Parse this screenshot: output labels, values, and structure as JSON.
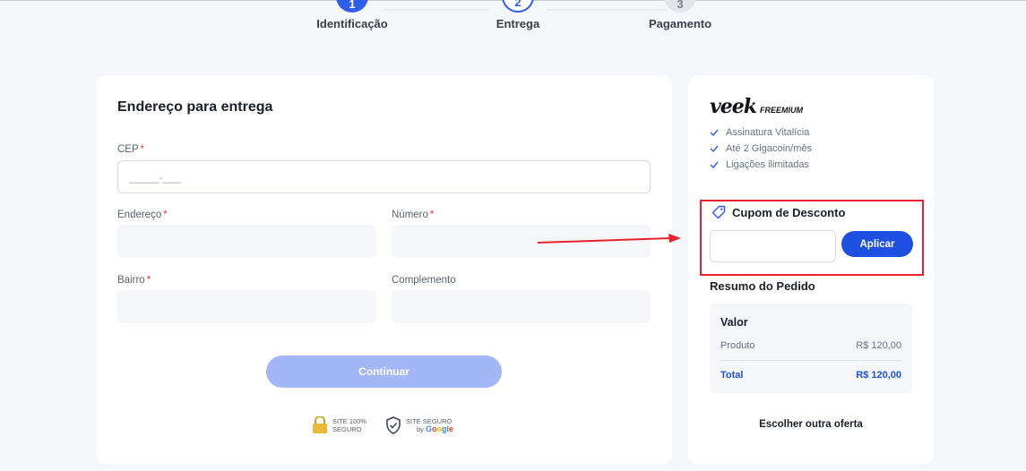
{
  "stepper": {
    "steps": [
      {
        "number": "1",
        "label": "Identificação",
        "state": "done"
      },
      {
        "number": "2",
        "label": "Entrega",
        "state": "active"
      },
      {
        "number": "3",
        "label": "Pagamento",
        "state": "pending"
      }
    ]
  },
  "address_form": {
    "title": "Endereço para entrega",
    "cep": {
      "label": "CEP",
      "required_mark": "*",
      "mask": "_____-___"
    },
    "endereco": {
      "label": "Endereço",
      "required_mark": "*",
      "value": ""
    },
    "numero": {
      "label": "Número",
      "required_mark": "*",
      "value": ""
    },
    "bairro": {
      "label": "Bairro",
      "required_mark": "*",
      "value": ""
    },
    "complemento": {
      "label": "Complemento",
      "value": ""
    },
    "continue_label": "Continuar",
    "badges": {
      "secure_site": {
        "line1": "SITE 100%",
        "line2": "SEGURO"
      },
      "google_secure": {
        "line1": "SITE SEGURO",
        "by": "by",
        "brand": "Google"
      }
    }
  },
  "offer": {
    "brand_name": "veek",
    "brand_tag": "FREEMIUM",
    "features": [
      "Assinatura Vitalícia",
      "Até 2 Gigacoin/mês",
      "Ligações ilimitadas"
    ],
    "coupon": {
      "title": "Cupom de Desconto",
      "value": "",
      "apply_label": "Aplicar"
    },
    "summary": {
      "title": "Resumo do Pedido",
      "heading": "Valor",
      "product_label": "Produto",
      "product_value": "R$ 120,00",
      "total_label": "Total",
      "total_value": "R$ 120,00"
    },
    "other_offer_label": "Escolher outra oferta"
  },
  "colors": {
    "primary": "#1f4fe0",
    "primary_disabled": "#a3b6f5",
    "required": "#e0354a",
    "annotation": "#e8232d",
    "background": "#f4f6fa"
  },
  "icons": [
    "check-icon",
    "tag-icon",
    "padlock-icon",
    "shield-check-icon",
    "arrow-annotation"
  ]
}
